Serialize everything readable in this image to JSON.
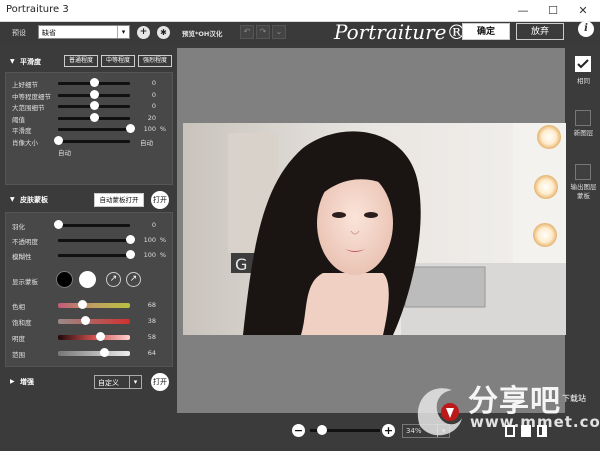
{
  "window": {
    "title": "Portraiture 3"
  },
  "toolbar": {
    "preset_label": "预设",
    "preset_value": "缺省",
    "preview_label": "预览*OH汉化",
    "logo": "Portraiture® 3",
    "ok_label": "确定",
    "cancel_label": "放弃",
    "info_icon": "i"
  },
  "smoothing": {
    "title": "平滑度",
    "chips": [
      "普通程度",
      "中等程度",
      "强烈程度"
    ],
    "sliders": [
      {
        "label": "上好细节",
        "value": "0",
        "pos": 0.5
      },
      {
        "label": "中等程度细节",
        "value": "0",
        "pos": 0.5
      },
      {
        "label": "大范围细节",
        "value": "0",
        "pos": 0.5
      },
      {
        "label": "阈值",
        "value": "20",
        "pos": 0.5
      },
      {
        "label": "平滑度",
        "value": "100",
        "unit": "%",
        "pos": 1.0
      },
      {
        "label": "肖像大小",
        "value": "自动",
        "pos": 0.0
      }
    ],
    "auto_caption": "自动"
  },
  "skin_mask": {
    "title": "皮肤蒙板",
    "auto_mask_btn": "自动蒙板打开",
    "toggle_btn": "打开",
    "sliders": [
      {
        "label": "羽化",
        "value": "0",
        "pos": 0.0
      },
      {
        "label": "不透明度",
        "value": "100",
        "unit": "%",
        "pos": 1.0
      },
      {
        "label": "模糊性",
        "value": "100",
        "unit": "%",
        "pos": 1.0
      }
    ],
    "show_mask_label": "显示蒙板",
    "color_sliders": [
      {
        "label": "色相",
        "value": "68",
        "pos": 0.33
      },
      {
        "label": "饱和度",
        "value": "38",
        "pos": 0.38
      },
      {
        "label": "明度",
        "value": "58",
        "pos": 0.58
      },
      {
        "label": "范围",
        "value": "64",
        "pos": 0.64
      }
    ]
  },
  "enhance": {
    "title": "增强",
    "preset_value": "自定义",
    "toggle_btn": "打开"
  },
  "right_panel": {
    "same_layer": "相同",
    "new_layer": "新图层",
    "output_mask": "输出图层蒙板"
  },
  "bottom": {
    "zoom_value": "34%"
  },
  "watermark": {
    "brand": "分享吧",
    "site": "www.mmet.com",
    "tag": "下载站"
  },
  "colors": {
    "accent": "#ffffff",
    "mask_black": "#000000",
    "mask_white": "#ffffff"
  }
}
